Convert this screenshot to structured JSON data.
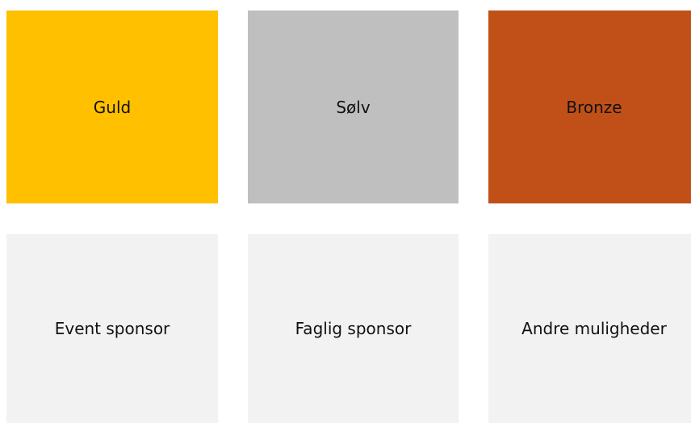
{
  "tiers": [
    {
      "label": "Guld",
      "color": "#FFC000"
    },
    {
      "label": "Sølv",
      "color": "#BFBFBF"
    },
    {
      "label": "Bronze",
      "color": "#C05018"
    }
  ],
  "options": [
    {
      "label": "Event sponsor",
      "color": "#F2F2F2"
    },
    {
      "label": "Faglig sponsor",
      "color": "#F2F2F2"
    },
    {
      "label": "Andre muligheder",
      "color": "#F2F2F2"
    }
  ]
}
